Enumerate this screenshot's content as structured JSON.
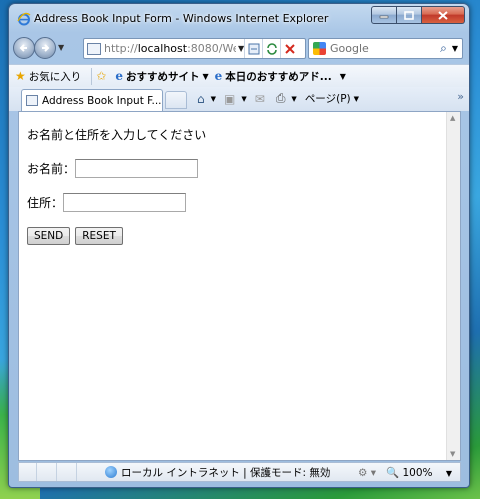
{
  "window": {
    "title": "Address Book Input Form - Windows Internet Explorer"
  },
  "navigation": {
    "url_prefix": "http://",
    "url_host": "localhost",
    "url_rest": ":8080/Web",
    "search_placeholder": "Google"
  },
  "favorites_bar": {
    "favorites_label": "お気に入り",
    "recommended_sites": "おすすめサイト",
    "todays_pick": "本日のおすすめアド..."
  },
  "tab": {
    "label": "Address Book Input F..."
  },
  "command_bar": {
    "page_label": "ページ(P)"
  },
  "page": {
    "heading": "お名前と住所を入力してください",
    "name_label": "お名前：",
    "name_value": "",
    "address_label": "住所：",
    "address_value": "",
    "send_label": "SEND",
    "reset_label": "RESET"
  },
  "status_bar": {
    "zone_text": "ローカル イントラネット | 保護モード: 無効",
    "zoom": "100%"
  }
}
